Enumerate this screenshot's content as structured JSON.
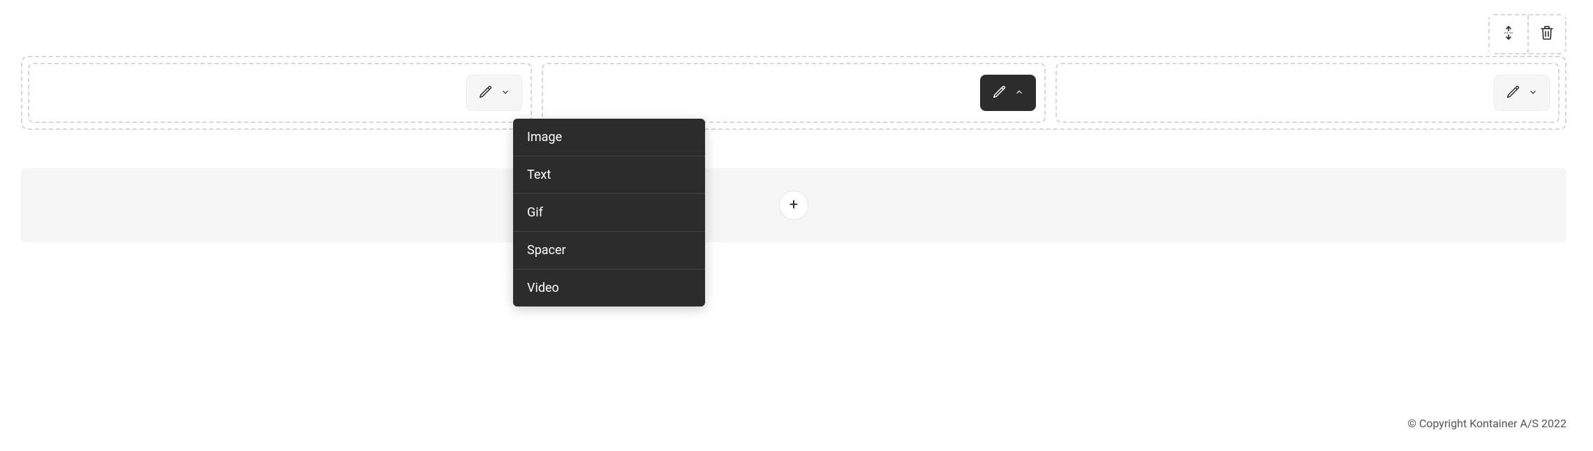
{
  "top_actions": {
    "move_icon": "move-icon",
    "trash_icon": "trash-icon"
  },
  "columns": [
    {
      "edit_state": "collapsed"
    },
    {
      "edit_state": "expanded"
    },
    {
      "edit_state": "collapsed"
    }
  ],
  "dropdown": {
    "items": [
      {
        "label": "Image"
      },
      {
        "label": "Text"
      },
      {
        "label": "Gif"
      },
      {
        "label": "Spacer"
      },
      {
        "label": "Video"
      }
    ]
  },
  "add_section": {
    "plus_label": "+"
  },
  "footer": {
    "copyright": "© Copyright Kontainer A/S 2022"
  }
}
